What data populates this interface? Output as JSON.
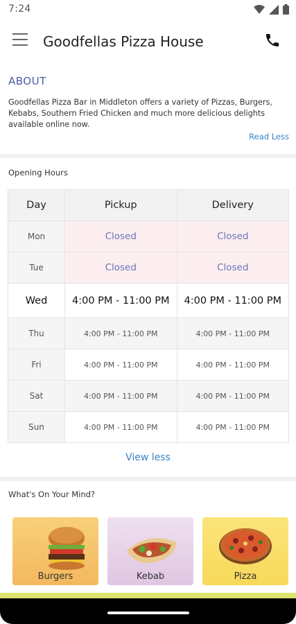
{
  "status_bar": {
    "time": "7:24",
    "icons": [
      "wifi-icon",
      "signal-icon",
      "battery-icon"
    ]
  },
  "app_bar": {
    "title": "Goodfellas Pizza House",
    "menu_icon": "hamburger-menu-icon",
    "call_icon": "phone-icon"
  },
  "about": {
    "title": "ABOUT",
    "text": "Goodfellas Pizza Bar in Middleton offers a variety of Pizzas, Burgers, Kebabs, Southern Fried Chicken and much more delicious delights available online now.",
    "toggle_label": "Read Less"
  },
  "opening_hours": {
    "title": "Opening Hours",
    "headers": [
      "Day",
      "Pickup",
      "Delivery"
    ],
    "rows": [
      {
        "day": "Mon",
        "pickup": "Closed",
        "delivery": "Closed",
        "closed": true
      },
      {
        "day": "Tue",
        "pickup": "Closed",
        "delivery": "Closed",
        "closed": true
      },
      {
        "day": "Wed",
        "pickup": "4:00 PM - 11:00 PM",
        "delivery": "4:00 PM - 11:00 PM",
        "today": true
      },
      {
        "day": "Thu",
        "pickup": "4:00 PM - 11:00 PM",
        "delivery": "4:00 PM - 11:00 PM"
      },
      {
        "day": "Fri",
        "pickup": "4:00 PM - 11:00 PM",
        "delivery": "4:00 PM - 11:00 PM"
      },
      {
        "day": "Sat",
        "pickup": "4:00 PM - 11:00 PM",
        "delivery": "4:00 PM - 11:00 PM"
      },
      {
        "day": "Sun",
        "pickup": "4:00 PM - 11:00 PM",
        "delivery": "4:00 PM - 11:00 PM"
      }
    ],
    "toggle_label": "View less"
  },
  "whats_on_your_mind": {
    "title": "What's On Your Mind?",
    "categories": [
      {
        "label": "Burgers",
        "icon": "burger-image"
      },
      {
        "label": "Kebab",
        "icon": "kebab-image"
      },
      {
        "label": "Pizza",
        "icon": "pizza-image"
      }
    ]
  },
  "colors": {
    "accent_blue": "#3a84c2",
    "about_title": "#4b5aa8",
    "closed_bg": "#fdeff0",
    "closed_text": "#6a72b8",
    "bottom_band": "#d9e36b"
  }
}
